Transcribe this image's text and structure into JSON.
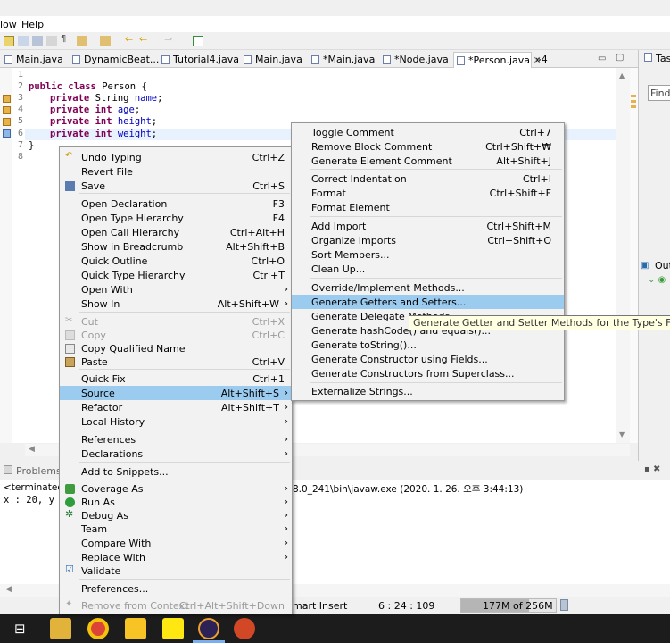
{
  "menubar": {
    "items": [
      "low",
      "Help"
    ]
  },
  "tabs": [
    {
      "label": "Main.java"
    },
    {
      "label": "DynamicBeat..."
    },
    {
      "label": "Tutorial4.java"
    },
    {
      "label": "Main.java"
    },
    {
      "label": "*Main.java"
    },
    {
      "label": "*Node.java"
    },
    {
      "label": "*Person.java"
    }
  ],
  "tab_overflow": "»4",
  "task_tab": "Task",
  "find_placeholder": "Find",
  "outline_tab": "Out",
  "editor": {
    "line_numbers": [
      "1",
      "2",
      "3",
      "4",
      "5",
      "6",
      "7",
      "8"
    ],
    "lines": {
      "l2_kw": "public class ",
      "l2_rest": "Person {",
      "l3_kw": "private ",
      "l3_type": "String ",
      "l3_name": "name",
      "l4_kw": "private int ",
      "l4_name": "age",
      "l5_kw": "private int ",
      "l5_name": "height",
      "l6_kw": "private int ",
      "l6_name": "weight",
      "semi": ";",
      "l7": "}"
    }
  },
  "console": {
    "tab": "Problems",
    "terminated": "<terminated>",
    "path": "8.0_241\\bin\\javaw.exe (2020. 1. 26. 오후 3:44:13)",
    "output": "x : 20, y"
  },
  "statusbar": {
    "mode": "mart Insert",
    "position": "6 : 24 : 109",
    "memory": "177M of 256M"
  },
  "context_menu": [
    {
      "label": "Undo Typing",
      "shortcut": "Ctrl+Z"
    },
    {
      "label": "Revert File",
      "shortcut": ""
    },
    {
      "label": "Save",
      "shortcut": "Ctrl+S"
    },
    {
      "label": "Open Declaration",
      "shortcut": "F3"
    },
    {
      "label": "Open Type Hierarchy",
      "shortcut": "F4"
    },
    {
      "label": "Open Call Hierarchy",
      "shortcut": "Ctrl+Alt+H"
    },
    {
      "label": "Show in Breadcrumb",
      "shortcut": "Alt+Shift+B"
    },
    {
      "label": "Quick Outline",
      "shortcut": "Ctrl+O"
    },
    {
      "label": "Quick Type Hierarchy",
      "shortcut": "Ctrl+T"
    },
    {
      "label": "Open With",
      "shortcut": ""
    },
    {
      "label": "Show In",
      "shortcut": "Alt+Shift+W"
    },
    {
      "label": "Cut",
      "shortcut": "Ctrl+X"
    },
    {
      "label": "Copy",
      "shortcut": "Ctrl+C"
    },
    {
      "label": "Copy Qualified Name",
      "shortcut": ""
    },
    {
      "label": "Paste",
      "shortcut": "Ctrl+V"
    },
    {
      "label": "Quick Fix",
      "shortcut": "Ctrl+1"
    },
    {
      "label": "Source",
      "shortcut": "Alt+Shift+S"
    },
    {
      "label": "Refactor",
      "shortcut": "Alt+Shift+T"
    },
    {
      "label": "Local History",
      "shortcut": ""
    },
    {
      "label": "References",
      "shortcut": ""
    },
    {
      "label": "Declarations",
      "shortcut": ""
    },
    {
      "label": "Add to Snippets...",
      "shortcut": ""
    },
    {
      "label": "Coverage As",
      "shortcut": ""
    },
    {
      "label": "Run As",
      "shortcut": ""
    },
    {
      "label": "Debug As",
      "shortcut": ""
    },
    {
      "label": "Team",
      "shortcut": ""
    },
    {
      "label": "Compare With",
      "shortcut": ""
    },
    {
      "label": "Replace With",
      "shortcut": ""
    },
    {
      "label": "Validate",
      "shortcut": ""
    },
    {
      "label": "Preferences...",
      "shortcut": ""
    },
    {
      "label": "Remove from Context",
      "shortcut": "Ctrl+Alt+Shift+Down"
    }
  ],
  "submenu": [
    {
      "label": "Toggle Comment",
      "shortcut": "Ctrl+7"
    },
    {
      "label": "Remove Block Comment",
      "shortcut": "Ctrl+Shift+₩"
    },
    {
      "label": "Generate Element Comment",
      "shortcut": "Alt+Shift+J"
    },
    {
      "label": "Correct Indentation",
      "shortcut": "Ctrl+I"
    },
    {
      "label": "Format",
      "shortcut": "Ctrl+Shift+F"
    },
    {
      "label": "Format Element",
      "shortcut": ""
    },
    {
      "label": "Add Import",
      "shortcut": "Ctrl+Shift+M"
    },
    {
      "label": "Organize Imports",
      "shortcut": "Ctrl+Shift+O"
    },
    {
      "label": "Sort Members...",
      "shortcut": ""
    },
    {
      "label": "Clean Up...",
      "shortcut": ""
    },
    {
      "label": "Override/Implement Methods...",
      "shortcut": ""
    },
    {
      "label": "Generate Getters and Setters...",
      "shortcut": ""
    },
    {
      "label": "Generate Delegate Methods...",
      "shortcut": ""
    },
    {
      "label": "Generate hashCode() and equals()...",
      "shortcut": ""
    },
    {
      "label": "Generate toString()...",
      "shortcut": ""
    },
    {
      "label": "Generate Constructor using Fields...",
      "shortcut": ""
    },
    {
      "label": "Generate Constructors from Superclass...",
      "shortcut": ""
    },
    {
      "label": "Externalize Strings...",
      "shortcut": ""
    }
  ],
  "tooltip": "Generate Getter and Setter Methods for the Type's Fields",
  "colors": {
    "highlight": "#9ccbf0",
    "keyword": "#7f0055",
    "field": "#0000c0"
  }
}
